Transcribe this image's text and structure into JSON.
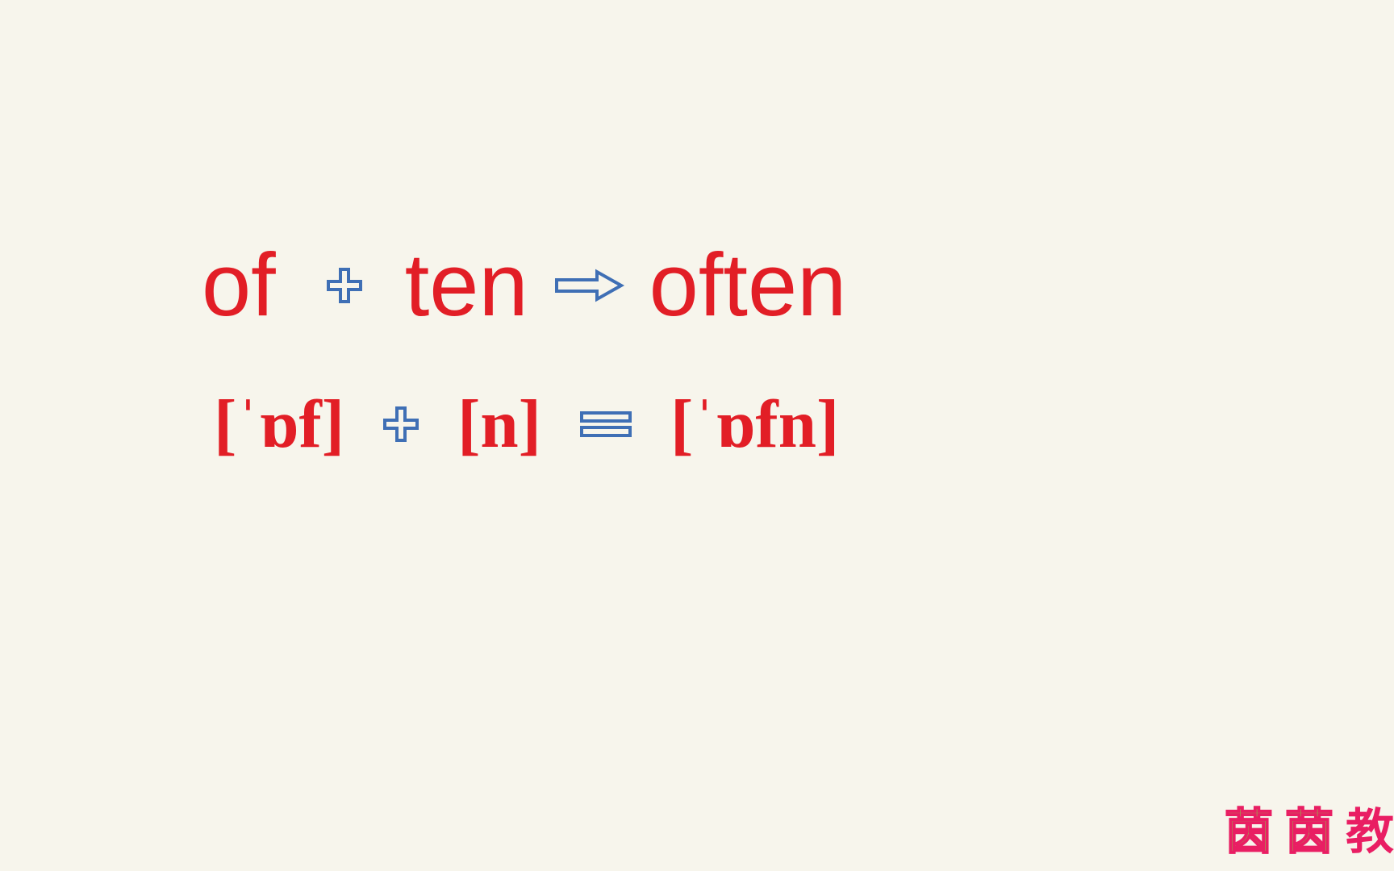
{
  "lesson": {
    "row1": {
      "part1": "of",
      "part2": "ten",
      "result": "often"
    },
    "row2": {
      "ipa1": "[ˈɒf]",
      "ipa2": "[n]",
      "ipaResult": "[ˈɒfn]"
    }
  },
  "watermark": {
    "char1": "茵",
    "char2": "茵",
    "char3": "教"
  },
  "colors": {
    "textRed": "#e21e26",
    "symbolBlue": "#3f6fb5",
    "background": "#f7f5ec"
  }
}
